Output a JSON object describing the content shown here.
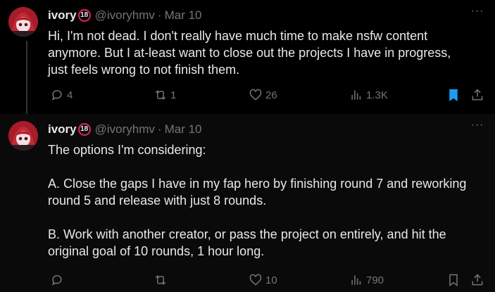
{
  "posts": [
    {
      "author": {
        "name": "ivory",
        "badge": "18",
        "handle": "@ivoryhmv",
        "date": "Mar 10"
      },
      "more_icon": "more-horizontal-icon",
      "text": "Hi, I'm not dead. I don't really have much time to make nsfw content\nanymore. But I at-least want to close out the projects I have in progress,\njust feels wrong to not finish them.",
      "stats": {
        "replies": "4",
        "reposts": "1",
        "likes": "26",
        "views": "1.3K"
      },
      "bookmarked": true
    },
    {
      "author": {
        "name": "ivory",
        "badge": "18",
        "handle": "@ivoryhmv",
        "date": "Mar 10"
      },
      "more_icon": "more-horizontal-icon",
      "text": "The options I'm considering:\n\nA. Close the gaps I have in my fap hero by finishing round 7 and reworking\nround 5 and release with just 8 rounds.\n\nB. Work with another creator, or pass the project on entirely, and hit the\noriginal goal of 10 rounds, 1 hour long.",
      "stats": {
        "replies": "",
        "reposts": "",
        "likes": "10",
        "views": "790"
      },
      "bookmarked": false
    }
  ],
  "colors": {
    "background": "#000000",
    "text": "#e7e9ea",
    "muted": "#71767b",
    "accent": "#1d9bf0",
    "badge_ring": "#e0245e"
  }
}
